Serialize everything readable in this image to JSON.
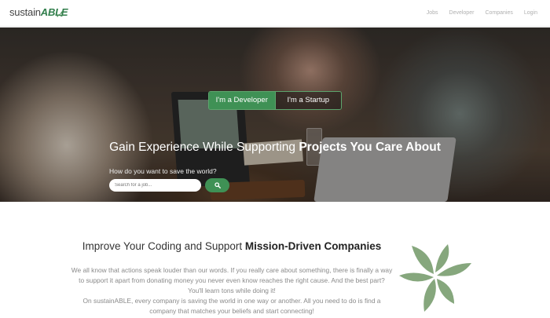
{
  "navbar": {
    "brand_prefix": "sustain",
    "brand_suffix": "ABLE",
    "links": [
      "Jobs",
      "Developer",
      "Companies",
      "Login"
    ]
  },
  "hero": {
    "toggle": {
      "developer_label": "I'm a Developer",
      "startup_label": "I'm a Startup",
      "active": "developer"
    },
    "title_normal": "Gain Experience While Supporting ",
    "title_strong": "Projects You Care About",
    "search_label": "How do you want to save the world?",
    "search_placeholder": "Search for a job...",
    "search_icon": "search-icon"
  },
  "content": {
    "title_normal": "Improve Your Coding and Support ",
    "title_strong": "Mission-Driven Companies",
    "paragraph1": "We all know that actions speak louder than our words. If you really care about something, there is finally a way to support it apart from donating money you never even know reaches the right cause. And the best part? You'll learn tons while doing it!",
    "paragraph2": "On sustainABLE, every company is saving the world in one way or another. All you need to do is find a company that matches your beliefs and start connecting!",
    "illustration_icon": "leaf-flower-icon"
  },
  "colors": {
    "brand_green": "#3f9155",
    "leaf_green": "#86a77d"
  }
}
